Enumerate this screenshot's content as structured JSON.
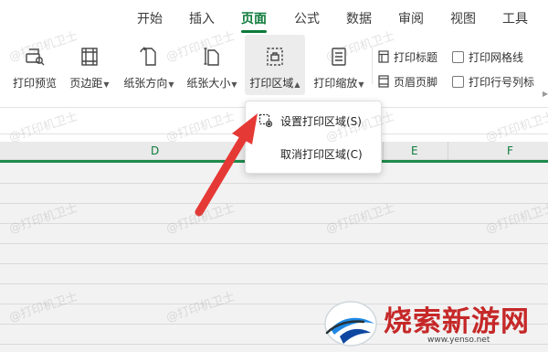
{
  "tabs": {
    "items": [
      "开始",
      "插入",
      "页面",
      "公式",
      "数据",
      "审阅",
      "视图",
      "工具"
    ],
    "active": "页面"
  },
  "ribbon": {
    "print_preview": "打印预览",
    "margins": "页边距",
    "orientation": "纸张方向",
    "size": "纸张大小",
    "print_area": "打印区域",
    "print_scale": "打印缩放",
    "print_titles": "打印标题",
    "header_footer": "页眉页脚",
    "print_gridlines": "打印网格线",
    "print_headings": "打印行号列标"
  },
  "sheet": {
    "columns": [
      "D",
      "E",
      "F"
    ]
  },
  "dropdown": {
    "set_print_area": "设置打印区域(S)",
    "clear_print_area": "取消打印区域(C)"
  },
  "watermark": "@打印机卫士",
  "logo": {
    "text": "烧索新游网",
    "url": "www.yenso.net"
  },
  "colors": {
    "accent": "#0d7a3a",
    "arrow": "#e53935",
    "logo": "#c62828"
  }
}
